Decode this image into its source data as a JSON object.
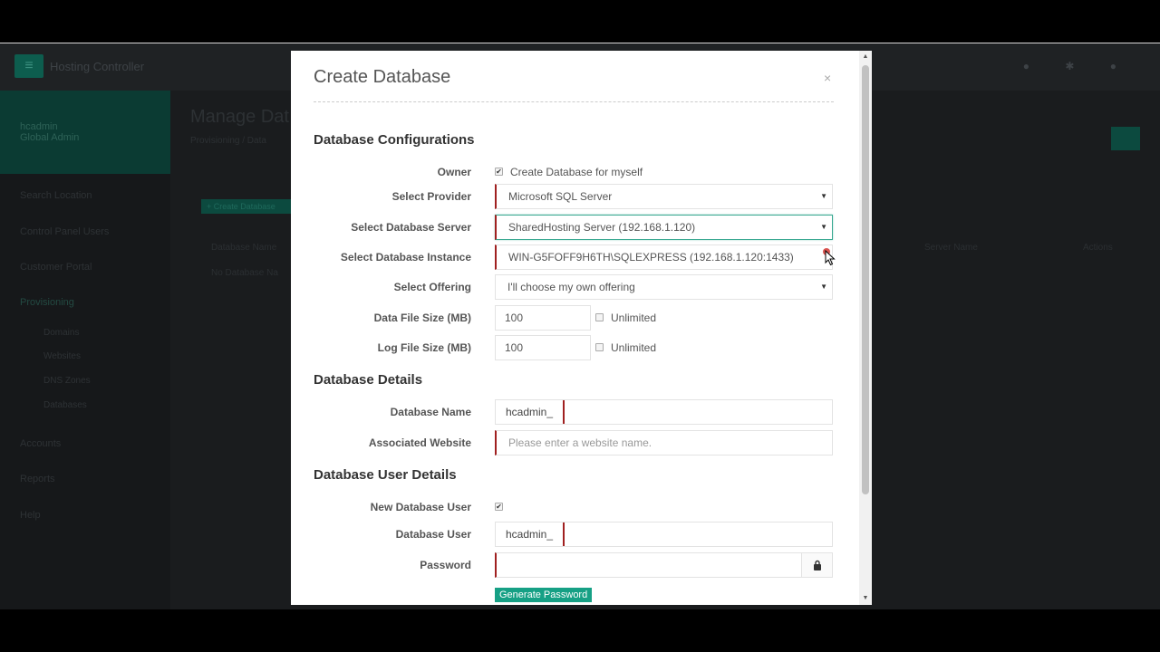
{
  "background": {
    "brand": "Hosting Controller",
    "user_name": "hcadmin",
    "user_role": "Global Admin",
    "nav": [
      "Search Location",
      "Control Panel Users",
      "Customer Portal",
      "Provisioning",
      "Accounts",
      "Reports",
      "Help"
    ],
    "subnav": [
      "Domains",
      "Websites",
      "DNS Zones",
      "Databases"
    ],
    "page_title": "Manage Dat",
    "breadcrumb": "Provisioning  /  Data",
    "create_btn": "+ Create Database",
    "table_headers": [
      "Database Name",
      "Server Name",
      "Actions"
    ],
    "table_empty": "No Database Na"
  },
  "modal": {
    "title": "Create Database",
    "close": "×",
    "sections": {
      "config": "Database Configurations",
      "details": "Database Details",
      "user": "Database User Details"
    },
    "owner": {
      "label": "Owner",
      "checkbox_label": "Create Database for myself",
      "checked": true
    },
    "provider": {
      "label": "Select Provider",
      "value": "Microsoft SQL Server"
    },
    "server": {
      "label": "Select Database Server",
      "value": "SharedHosting Server (192.168.1.120)"
    },
    "instance": {
      "label": "Select Database Instance",
      "value": "WIN-G5FOFF9H6TH\\SQLEXPRESS (192.168.1.120:1433)"
    },
    "offering": {
      "label": "Select Offering",
      "value": "I'll choose my own offering"
    },
    "data_size": {
      "label": "Data File Size (MB)",
      "value": "100",
      "unlimited_label": "Unlimited",
      "unlimited": false
    },
    "log_size": {
      "label": "Log File Size (MB)",
      "value": "100",
      "unlimited_label": "Unlimited",
      "unlimited": false
    },
    "db_name": {
      "label": "Database Name",
      "prefix": "hcadmin_",
      "value": ""
    },
    "website": {
      "label": "Associated Website",
      "placeholder": "Please enter a website name."
    },
    "new_user": {
      "label": "New Database User",
      "checked": true
    },
    "db_user": {
      "label": "Database User",
      "prefix": "hcadmin_",
      "value": ""
    },
    "password": {
      "label": "Password",
      "value": ""
    },
    "generate_btn": "Generate Password"
  },
  "colors": {
    "accent": "#16a085",
    "error": "#a02020",
    "focus": "#38a891"
  },
  "icons": {
    "owner_check": "✔",
    "new_user_check": "✔",
    "caret": "▼",
    "lock": "lock-icon"
  }
}
